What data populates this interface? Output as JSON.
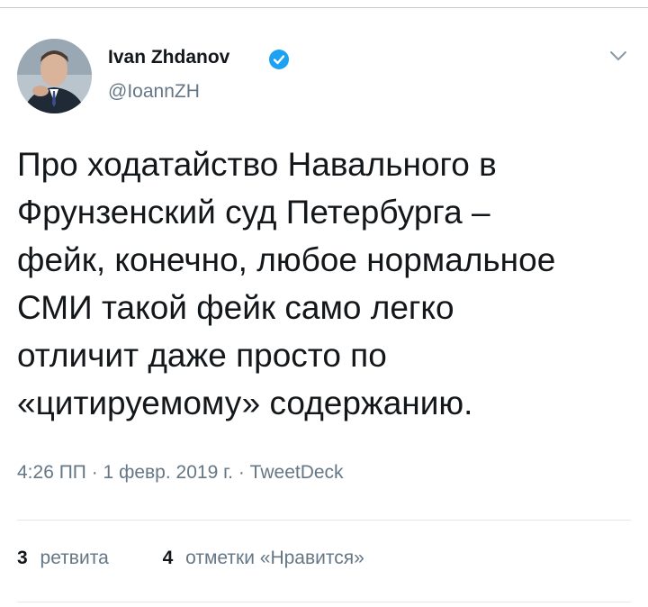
{
  "author": {
    "name": "Ivan Zhdanov",
    "handle": "@IoannZH",
    "verified": true
  },
  "tweet": {
    "text": "Про ходатайство Навального в\nФрунзенский суд Петербурга –\nфейк, конечно, любое нормальное\nСМИ такой фейк само легко\nотличит даже просто по\n«цитируемому» содержанию.",
    "timestamp": "4:26 ПП · 1 февр. 2019 г. · TweetDeck"
  },
  "stats": {
    "retweets_count": "3",
    "retweets_label": "ретвита",
    "likes_count": "4",
    "likes_label": "отметки «Нравится»"
  },
  "icons": {
    "verified": "verified-badge-icon",
    "menu": "chevron-down-icon"
  },
  "colors": {
    "verified_blue": "#1da1f2",
    "secondary_text": "#657786",
    "primary_text": "#14171a"
  }
}
